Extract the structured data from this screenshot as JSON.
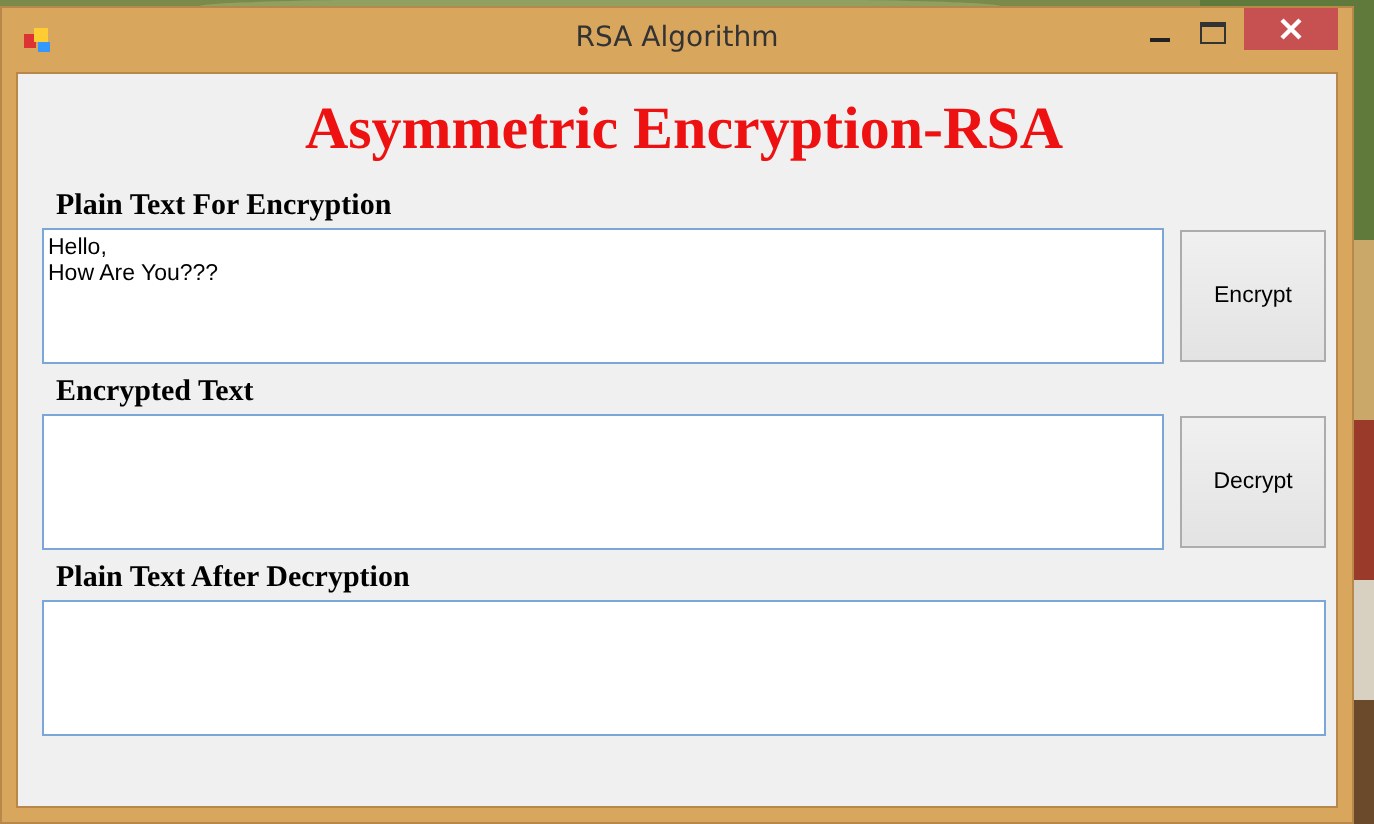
{
  "window": {
    "title": "RSA Algorithm"
  },
  "heading": "Asymmetric Encryption-RSA",
  "sections": [
    {
      "label": "Plain Text For Encryption",
      "value": "Hello,\nHow Are You???",
      "button": "Encrypt"
    },
    {
      "label": "Encrypted Text",
      "button": "Decrypt"
    },
    {
      "label": "Plain Text After Decryption"
    }
  ]
}
